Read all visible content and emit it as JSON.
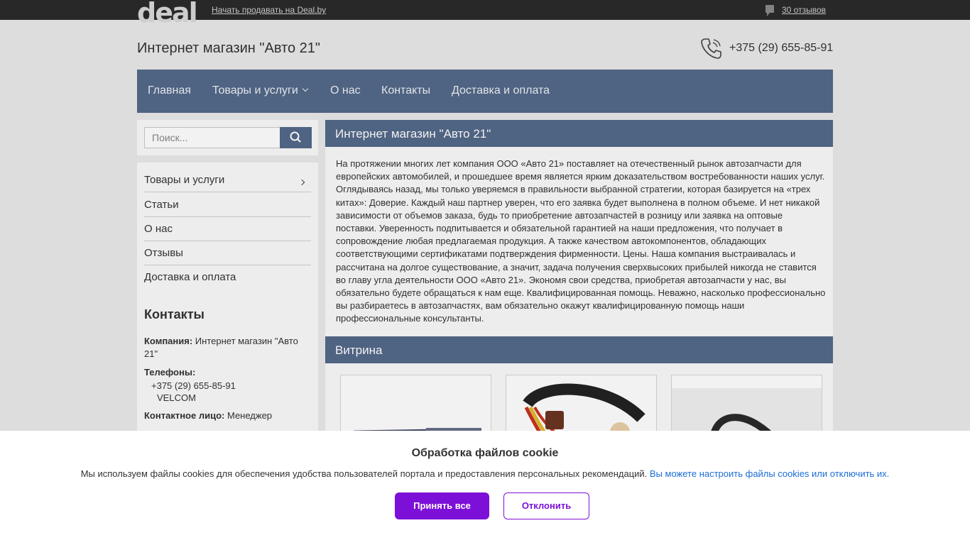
{
  "topbar": {
    "logo": "deal",
    "sell_link": "Начать продавать на Deal.by",
    "reviews_link": "30 отзывов"
  },
  "header": {
    "title": "Интернет магазин \"Авто 21\"",
    "phone": "+375 (29) 655-85-91"
  },
  "nav": {
    "items": [
      "Главная",
      "Товары и услуги",
      "О нас",
      "Контакты",
      "Доставка и оплата"
    ]
  },
  "search": {
    "placeholder": "Поиск..."
  },
  "sidebar": {
    "menu": [
      "Товары и услуги",
      "Статьи",
      "О нас",
      "Отзывы",
      "Доставка и оплата"
    ],
    "contacts_title": "Контакты",
    "company_label": "Компания:",
    "company_value": "Интернет магазин \"Авто 21\"",
    "phones_label": "Телефоны:",
    "phone": "+375 (29) 655-85-91",
    "operator": "VELCOM",
    "contact_label": "Контактное лицо:",
    "contact_value": "Менеджер"
  },
  "main": {
    "title": "Интернет магазин \"Авто 21\"",
    "about_text": "На протяжении многих лет компания ООО «Авто 21» поставляет на отечественный рынок автозапчасти для европейских автомобилей, и прошедшее время является ярким доказательством востребованности наших услуг. Оглядываясь назад, мы только уверяемся в правильности выбранной стратегии, которая базируется на «трех китах»: Доверие. Каждый наш партнер уверен, что его заявка будет выполнена в полном объеме. И нет никакой зависимости от объемов заказа, будь то приобретение автозапчастей в розницу или заявка на оптовые поставки. Уверенность подпитывается и обязательной гарантией на наши предложения, что получает в сопровождение любая предлагаемая продукция. А также качеством автокомпонентов, обладающих соответствующими сертификатами подтверждения фирменности. Цены. Наша компания выстраивалась и рассчитана на долгое существование, а значит, задача получения сверхвысоких прибылей никогда не ставится во главу угла деятельности ООО «Авто 21». Экономя свои средства, приобретая автозапчасти у нас, вы обязательно будете обращаться к нам еще. Квалифицированная помощь. Неважно, насколько профессионально вы разбираетесь в автозапчастях, вам обязательно окажут квалифицированную помощь наши профессиональные консультанты.",
    "vitrina_title": "Витрина"
  },
  "cookie": {
    "title": "Обработка файлов cookie",
    "text": "Мы используем файлы cookies для обеспечения удобства пользователей портала и предоставления персональных рекомендаций.",
    "link": "Вы можете настроить файлы cookies или отключить их.",
    "accept": "Принять все",
    "decline": "Отклонить"
  },
  "colors": {
    "nav_bg": "#54698a",
    "accent": "#7d10d8",
    "link": "#1a6dd6"
  }
}
